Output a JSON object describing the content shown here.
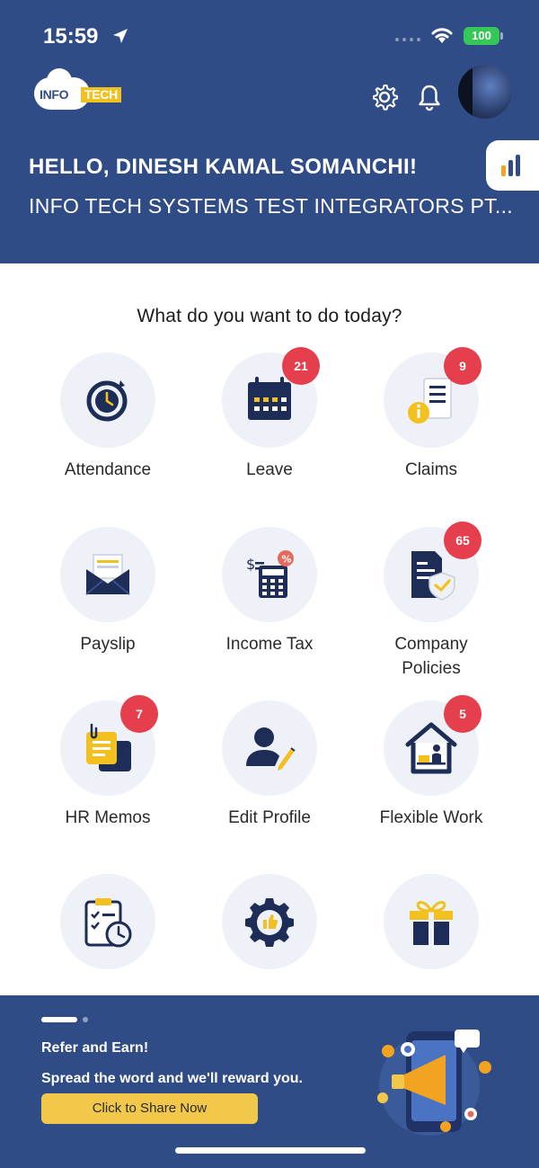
{
  "status_bar": {
    "time": "15:59",
    "battery": "100"
  },
  "header": {
    "logo_text_a": "INFO",
    "logo_text_b": "TECH",
    "greeting": "HELLO, DINESH KAMAL SOMANCHI!",
    "company": "INFO TECH SYSTEMS TEST INTEGRATORS PT..."
  },
  "main": {
    "prompt": "What do you want to do today?",
    "tiles": [
      {
        "label": "Attendance",
        "icon": "attendance-clock-icon",
        "badge": ""
      },
      {
        "label": "Leave",
        "icon": "calendar-icon",
        "badge": "21"
      },
      {
        "label": "Claims",
        "icon": "claims-receipt-icon",
        "badge": "9"
      },
      {
        "label": "Payslip",
        "icon": "envelope-icon",
        "badge": ""
      },
      {
        "label": "Income Tax",
        "icon": "calculator-icon",
        "badge": ""
      },
      {
        "label": "Company\nPolicies",
        "icon": "policy-shield-icon",
        "badge": "65"
      },
      {
        "label": "HR Memos",
        "icon": "memo-notes-icon",
        "badge": "7"
      },
      {
        "label": "Edit Profile",
        "icon": "edit-profile-icon",
        "badge": ""
      },
      {
        "label": "Flexible Work",
        "icon": "work-from-home-icon",
        "badge": "5"
      },
      {
        "label": "",
        "icon": "timesheet-icon",
        "badge": ""
      },
      {
        "label": "",
        "icon": "feedback-gear-icon",
        "badge": ""
      },
      {
        "label": "",
        "icon": "gift-icon",
        "badge": ""
      }
    ]
  },
  "banner": {
    "title": "Refer and Earn!",
    "subtitle": "Spread the word and we'll reward you.",
    "button": "Click to Share Now"
  },
  "colors": {
    "primary": "#2f4c87",
    "accent": "#f2c11f",
    "badge": "#e53e4d",
    "tile_bg": "#eef1f7"
  }
}
